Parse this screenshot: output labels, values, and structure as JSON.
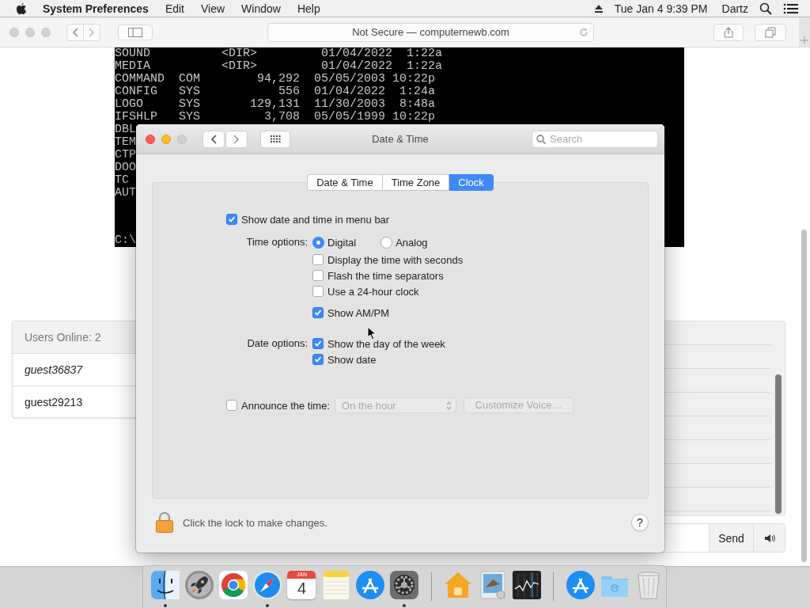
{
  "menu_bar": {
    "app": "System Preferences",
    "menus": [
      "Edit",
      "View",
      "Window",
      "Help"
    ],
    "clock": "Tue Jan 4  9:39 PM",
    "user": "Dartz"
  },
  "browser": {
    "address": "Not Secure — computernewb.com"
  },
  "terminal": {
    "lines": [
      "SOUND          <DIR>         01/04/2022  1:22a",
      "MEDIA          <DIR>         01/04/2022  1:22a",
      "COMMAND  COM        94,292  05/05/2003 10:22p",
      "CONFIG   SYS           556  01/04/2022  1:24a",
      "LOGO     SYS       129,131  11/30/2003  8:48a",
      "IFSHLP   SYS         3,708  05/05/1999 10:22p",
      "DBL",
      "TEM",
      "CTP",
      "DOO",
      "TC",
      "AUT"
    ],
    "prompt": "C:\\"
  },
  "users_panel": {
    "header": "Users Online: 2",
    "users": [
      {
        "name": "guest36837",
        "is_self": true
      },
      {
        "name": "guest29213",
        "is_self": false
      }
    ]
  },
  "chat": {
    "send": "Send"
  },
  "prefs": {
    "title": "Date & Time",
    "search_placeholder": "Search",
    "tabs": [
      {
        "label": "Date & Time",
        "selected": false
      },
      {
        "label": "Time Zone",
        "selected": false
      },
      {
        "label": "Clock",
        "selected": true
      }
    ],
    "show_in_menu_bar": {
      "label": "Show date and time in menu bar",
      "checked": true
    },
    "time_options_label": "Time options:",
    "time_styles": [
      {
        "label": "Digital",
        "selected": true
      },
      {
        "label": "Analog",
        "selected": false
      }
    ],
    "time_checks": [
      {
        "label": "Display the time with seconds",
        "checked": false
      },
      {
        "label": "Flash the time separators",
        "checked": false
      },
      {
        "label": "Use a 24-hour clock",
        "checked": false
      },
      {
        "label": "Show AM/PM",
        "checked": true
      }
    ],
    "date_options_label": "Date options:",
    "date_checks": [
      {
        "label": "Show the day of the week",
        "checked": true
      },
      {
        "label": "Show date",
        "checked": true
      }
    ],
    "announce": {
      "label": "Announce the time:",
      "checked": false,
      "interval": "On the hour",
      "disabled": true,
      "customize": "Customize Voice…"
    },
    "lock_text": "Click the lock to make changes.",
    "help": "?"
  },
  "dock": {
    "items": [
      {
        "kind": "finder",
        "running": true
      },
      {
        "kind": "launchpad",
        "running": false
      },
      {
        "kind": "chrome",
        "running": false
      },
      {
        "kind": "safari",
        "running": true
      },
      {
        "kind": "calendar",
        "running": false,
        "month": "JAN",
        "day": "4"
      },
      {
        "kind": "notes",
        "running": false
      },
      {
        "kind": "appstore",
        "running": false
      },
      {
        "kind": "sysprefs",
        "running": true
      },
      {
        "kind": "separator"
      },
      {
        "kind": "home",
        "running": false
      },
      {
        "kind": "preview",
        "running": false
      },
      {
        "kind": "stocks",
        "running": false
      },
      {
        "kind": "separator"
      },
      {
        "kind": "appstore",
        "running": false
      },
      {
        "kind": "downloads",
        "running": false
      },
      {
        "kind": "trash",
        "running": false
      }
    ]
  }
}
